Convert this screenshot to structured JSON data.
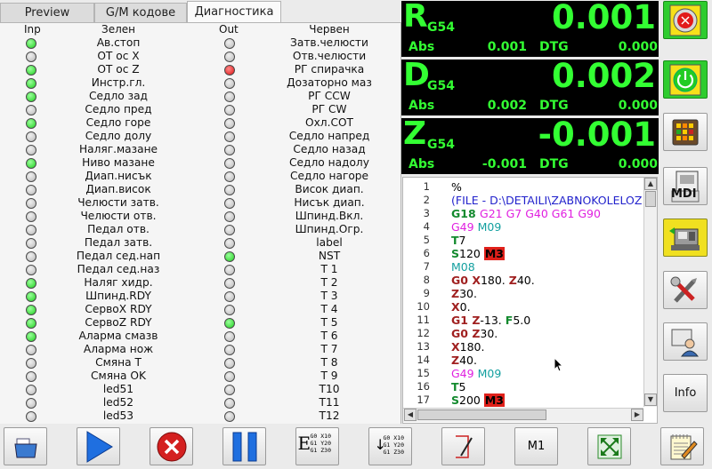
{
  "tabs": [
    {
      "label": "Preview"
    },
    {
      "label": "G/M кодове"
    },
    {
      "label": "Диагностика",
      "active": true
    }
  ],
  "diagnostics": {
    "headers": {
      "inp": "Inp",
      "in_name": "Зелен",
      "out": "Out",
      "out_name": "Червен"
    },
    "rows": [
      {
        "in_state": "green",
        "in_label": "Ав.стоп",
        "out_state": "off",
        "out_label": "Затв.челюсти"
      },
      {
        "in_state": "off",
        "in_label": "OT oc X",
        "out_state": "off",
        "out_label": "Отв.челюсти"
      },
      {
        "in_state": "green",
        "in_label": "OT oc Z",
        "out_state": "red",
        "out_label": "РГ спирачка"
      },
      {
        "in_state": "green",
        "in_label": "Инстр.гл.",
        "out_state": "off",
        "out_label": "Дозаторно маз"
      },
      {
        "in_state": "green",
        "in_label": "Седло зад",
        "out_state": "off",
        "out_label": "РГ CCW"
      },
      {
        "in_state": "off",
        "in_label": "Седло пред",
        "out_state": "off",
        "out_label": "РГ CW"
      },
      {
        "in_state": "green",
        "in_label": "Седло горе",
        "out_state": "off",
        "out_label": "Охл.СОТ"
      },
      {
        "in_state": "off",
        "in_label": "Седло долу",
        "out_state": "off",
        "out_label": "Седло напред"
      },
      {
        "in_state": "off",
        "in_label": "Наляг.мазане",
        "out_state": "off",
        "out_label": "Седло назад"
      },
      {
        "in_state": "green",
        "in_label": "Ниво мазане",
        "out_state": "off",
        "out_label": "Седло надолу"
      },
      {
        "in_state": "off",
        "in_label": "Диап.нисък",
        "out_state": "off",
        "out_label": "Седло нагоре"
      },
      {
        "in_state": "off",
        "in_label": "Диап.висок",
        "out_state": "off",
        "out_label": "Висок диап."
      },
      {
        "in_state": "off",
        "in_label": "Челюсти затв.",
        "out_state": "off",
        "out_label": "Нисък диап."
      },
      {
        "in_state": "off",
        "in_label": "Челюсти отв.",
        "out_state": "off",
        "out_label": "Шпинд.Вкл."
      },
      {
        "in_state": "off",
        "in_label": "Педал отв.",
        "out_state": "off",
        "out_label": "Шпинд.Огр."
      },
      {
        "in_state": "off",
        "in_label": "Педал затв.",
        "out_state": "off",
        "out_label": "label"
      },
      {
        "in_state": "off",
        "in_label": "Педал сед.нап",
        "out_state": "green",
        "out_label": "NST"
      },
      {
        "in_state": "off",
        "in_label": "Педал сед.наз",
        "out_state": "off",
        "out_label": "T 1"
      },
      {
        "in_state": "green",
        "in_label": "Наляг хидр.",
        "out_state": "off",
        "out_label": "T 2"
      },
      {
        "in_state": "green",
        "in_label": "Шпинд.RDY",
        "out_state": "off",
        "out_label": "T 3"
      },
      {
        "in_state": "green",
        "in_label": "СервоX RDY",
        "out_state": "off",
        "out_label": "T 4"
      },
      {
        "in_state": "green",
        "in_label": "СервоZ RDY",
        "out_state": "green",
        "out_label": "T 5"
      },
      {
        "in_state": "green",
        "in_label": "Аларма смазв",
        "out_state": "off",
        "out_label": "T 6"
      },
      {
        "in_state": "off",
        "in_label": "Аларма нож",
        "out_state": "off",
        "out_label": "T 7"
      },
      {
        "in_state": "off",
        "in_label": "Смяна T",
        "out_state": "off",
        "out_label": "T 8"
      },
      {
        "in_state": "off",
        "in_label": "Смяна OK",
        "out_state": "off",
        "out_label": "T 9"
      },
      {
        "in_state": "off",
        "in_label": "led51",
        "out_state": "off",
        "out_label": "T10"
      },
      {
        "in_state": "off",
        "in_label": "led52",
        "out_state": "off",
        "out_label": "T11"
      },
      {
        "in_state": "off",
        "in_label": "led53",
        "out_state": "off",
        "out_label": "T12"
      }
    ]
  },
  "dro": [
    {
      "axis": "R",
      "coord": "G54",
      "value": "0.001",
      "abs_label": "Abs",
      "abs_value": "0.001",
      "dtg_label": "DTG",
      "dtg_value": "0.000"
    },
    {
      "axis": "D",
      "coord": "G54",
      "value": "0.002",
      "abs_label": "Abs",
      "abs_value": "0.002",
      "dtg_label": "DTG",
      "dtg_value": "0.000"
    },
    {
      "axis": "Z",
      "coord": "G54",
      "value": "-0.001",
      "abs_label": "Abs",
      "abs_value": "-0.001",
      "dtg_label": "DTG",
      "dtg_value": "0.000"
    }
  ],
  "gcode": {
    "colors": {
      "g": "#138a2e",
      "m": "#e020e0",
      "axis": "#a02020",
      "teal": "#14a0a0",
      "blue": "#2222cc",
      "highlight_bg": "#e0201a"
    },
    "lines": [
      {
        "num": "1",
        "segs": [
          {
            "t": "%",
            "c": "#000"
          }
        ]
      },
      {
        "num": "2",
        "segs": [
          {
            "t": "(FILE - D:\\DETAILI\\ZABNOKOLELOZ",
            "c": "#2222cc"
          }
        ]
      },
      {
        "num": "3",
        "segs": [
          {
            "t": "G18 ",
            "c": "#138a2e",
            "b": true
          },
          {
            "t": "G21 G7 G40 G61 G90",
            "c": "#e020e0"
          }
        ]
      },
      {
        "num": "4",
        "segs": [
          {
            "t": "G49 ",
            "c": "#e020e0"
          },
          {
            "t": "M09",
            "c": "#14a0a0"
          }
        ]
      },
      {
        "num": "5",
        "segs": [
          {
            "t": "T",
            "c": "#138a2e",
            "b": true
          },
          {
            "t": "7",
            "c": "#000"
          }
        ]
      },
      {
        "num": "6",
        "segs": [
          {
            "t": "S",
            "c": "#138a2e",
            "b": true
          },
          {
            "t": "120 ",
            "c": "#000"
          },
          {
            "t": "M3",
            "c": "#000",
            "hl": true
          }
        ]
      },
      {
        "num": "7",
        "segs": [
          {
            "t": "M08",
            "c": "#14a0a0"
          }
        ]
      },
      {
        "num": "8",
        "segs": [
          {
            "t": "G0 ",
            "c": "#a02020",
            "b": true
          },
          {
            "t": "X",
            "c": "#a02020",
            "b": true
          },
          {
            "t": "180. ",
            "c": "#000"
          },
          {
            "t": "Z",
            "c": "#a02020",
            "b": true
          },
          {
            "t": "40.",
            "c": "#000"
          }
        ]
      },
      {
        "num": "9",
        "segs": [
          {
            "t": "Z",
            "c": "#a02020",
            "b": true
          },
          {
            "t": "30.",
            "c": "#000"
          }
        ]
      },
      {
        "num": "10",
        "segs": [
          {
            "t": "X",
            "c": "#a02020",
            "b": true
          },
          {
            "t": "0.",
            "c": "#000"
          }
        ]
      },
      {
        "num": "11",
        "segs": [
          {
            "t": "G1 ",
            "c": "#a02020",
            "b": true
          },
          {
            "t": "Z",
            "c": "#a02020",
            "b": true
          },
          {
            "t": "-13. ",
            "c": "#000"
          },
          {
            "t": "F",
            "c": "#138a2e",
            "b": true
          },
          {
            "t": "5.0",
            "c": "#000"
          }
        ]
      },
      {
        "num": "12",
        "segs": [
          {
            "t": "G0 ",
            "c": "#a02020",
            "b": true
          },
          {
            "t": "Z",
            "c": "#a02020",
            "b": true
          },
          {
            "t": "30.",
            "c": "#000"
          }
        ]
      },
      {
        "num": "13",
        "segs": [
          {
            "t": "X",
            "c": "#a02020",
            "b": true
          },
          {
            "t": "180.",
            "c": "#000"
          }
        ]
      },
      {
        "num": "14",
        "segs": [
          {
            "t": "Z",
            "c": "#a02020",
            "b": true
          },
          {
            "t": "40.",
            "c": "#000"
          }
        ]
      },
      {
        "num": "15",
        "segs": [
          {
            "t": "G49 ",
            "c": "#e020e0"
          },
          {
            "t": "M09",
            "c": "#14a0a0"
          }
        ]
      },
      {
        "num": "16",
        "segs": [
          {
            "t": "T",
            "c": "#138a2e",
            "b": true
          },
          {
            "t": "5",
            "c": "#000"
          }
        ]
      },
      {
        "num": "17",
        "segs": [
          {
            "t": "S",
            "c": "#138a2e",
            "b": true
          },
          {
            "t": "200 ",
            "c": "#000"
          },
          {
            "t": "M3",
            "c": "#000",
            "hl": true
          }
        ]
      }
    ]
  },
  "side_buttons": {
    "mdi_label": "MDI",
    "info_label": "Info"
  },
  "toolbar": {
    "m1_label": "M1",
    "gcode_icon_text": {
      "a": "G0 X10",
      "b": "G1 Y20",
      "c": "G1 Z30"
    }
  }
}
